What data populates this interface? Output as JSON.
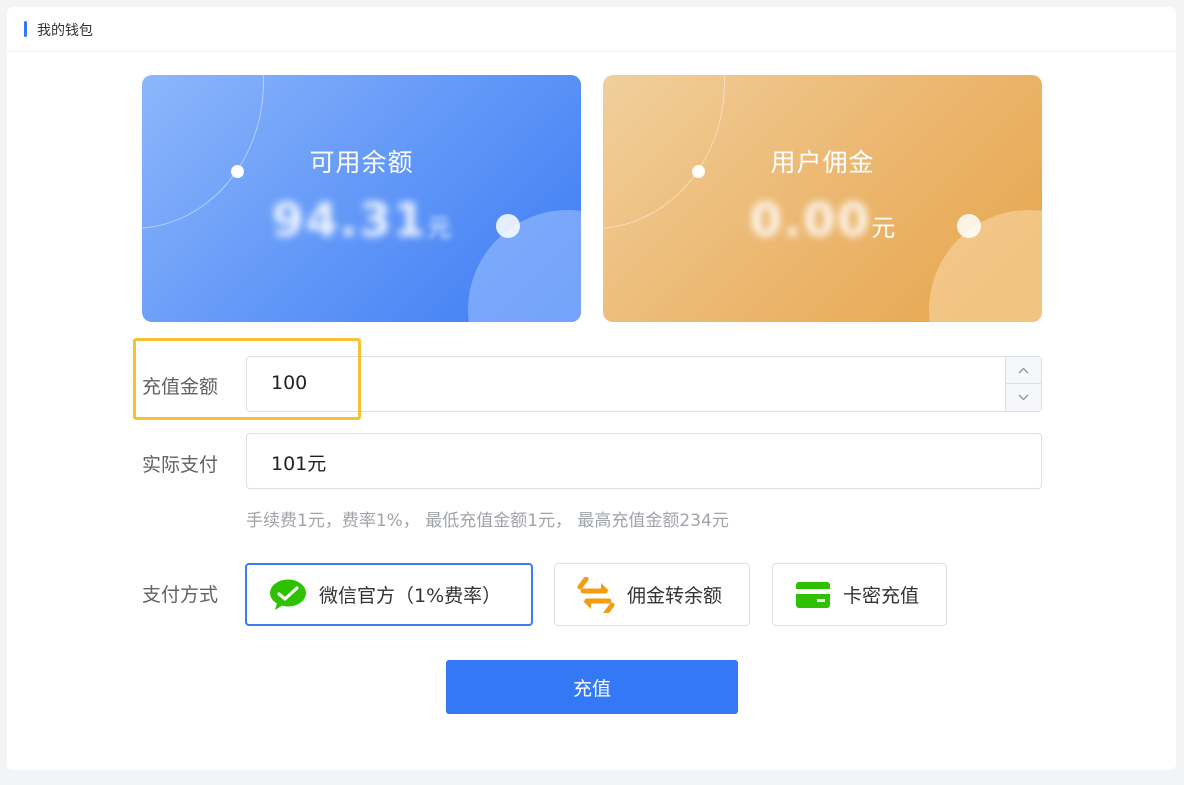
{
  "header": {
    "title": "我的钱包"
  },
  "cards": {
    "balance": {
      "label": "可用余额",
      "amount": "94.31",
      "unit": "元"
    },
    "commission": {
      "label": "用户佣金",
      "amount": "0.00",
      "unit": "元"
    }
  },
  "form": {
    "recharge_label": "充值金额",
    "recharge_value": "100",
    "actual_label": "实际支付",
    "actual_value": "101元",
    "hint": "手续费1元，费率1%， 最低充值金额1元， 最高充值金额234元",
    "method_label": "支付方式",
    "methods": [
      {
        "label": "微信官方（1%费率）",
        "icon": "wechat-icon",
        "selected": true
      },
      {
        "label": "佣金转余额",
        "icon": "transfer-arrows-icon",
        "selected": false
      },
      {
        "label": "卡密充值",
        "icon": "card-icon",
        "selected": false
      }
    ],
    "submit_label": "充值"
  },
  "colors": {
    "primary": "#3478f6",
    "highlight": "#f8c033",
    "wechat": "#2dc100",
    "transfer": "#f39c12",
    "card": "#2dc100"
  }
}
